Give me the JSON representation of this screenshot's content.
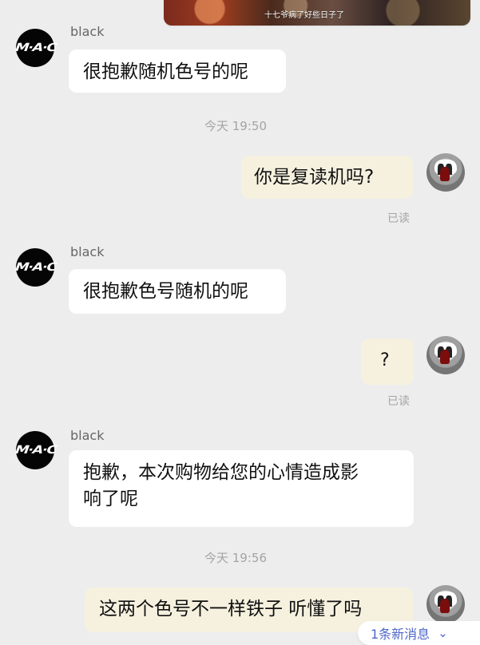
{
  "top_card": {
    "caption": "十七爷病了好些日子了"
  },
  "chat": {
    "sender_name": "black",
    "avatar_label": "M·A·C",
    "messages": [
      {
        "text": "很抱歉随机色号的呢"
      },
      {
        "time": "今天 19:50"
      },
      {
        "text": "你是复读机吗?",
        "status": "已读"
      },
      {
        "text": "很抱歉色号随机的呢"
      },
      {
        "text": "?",
        "status": "已读"
      },
      {
        "text_line1": "抱歉，本次购物给您的心情造成影",
        "text_line2": "响了呢"
      },
      {
        "time": "今天 19:56"
      },
      {
        "text": "这两个色号不一样铁子 听懂了吗"
      }
    ]
  },
  "new_message_pill": {
    "label": "1条新消息",
    "icon": "double-chevron-down-icon"
  }
}
